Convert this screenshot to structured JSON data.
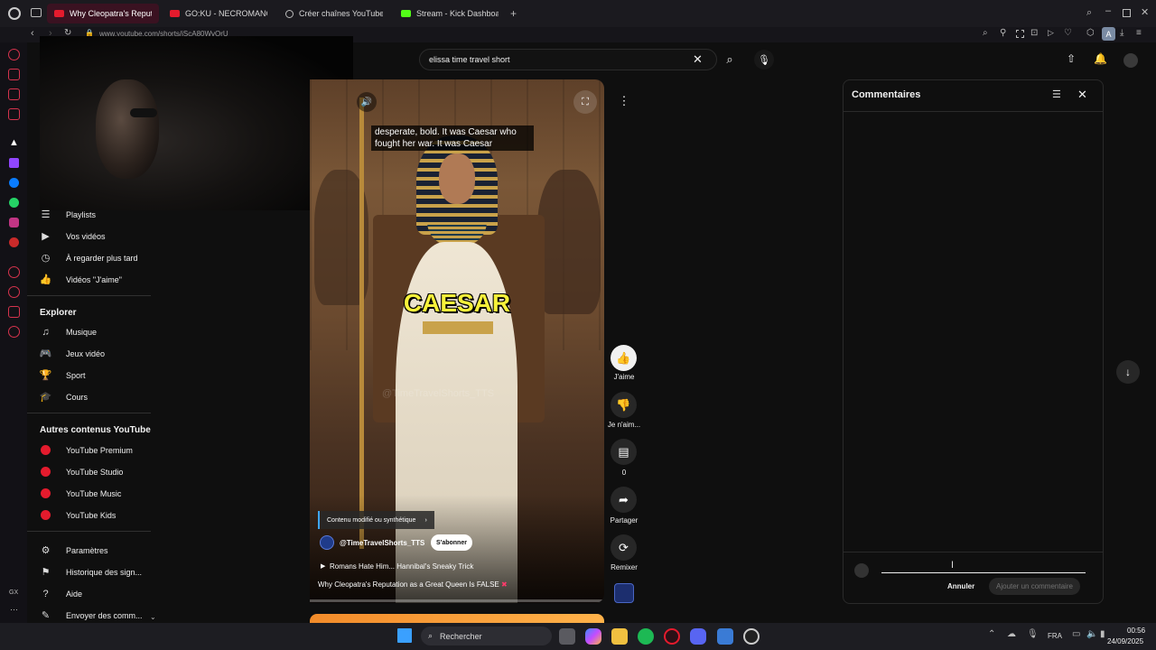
{
  "browser": {
    "tabs": [
      {
        "label": "Why Cleopatra's Reputat",
        "active": true
      },
      {
        "label": "GO:KU - NECROMANCY",
        "active": false
      },
      {
        "label": "Créer chaînes YouTube K",
        "active": false
      },
      {
        "label": "Stream - Kick Dashboard",
        "active": false
      }
    ],
    "url": "www.youtube.com/shorts/jScA80WvOrU"
  },
  "search": {
    "value": "elissa time travel short"
  },
  "nav": {
    "you_items": [
      "Playlists",
      "Vos vidéos",
      "À regarder plus tard",
      "Vidéos \"J'aime\""
    ],
    "explore_heading": "Explorer",
    "explore_items": [
      "Musique",
      "Jeux vidéo",
      "Sport",
      "Cours"
    ],
    "more_heading": "Autres contenus YouTube",
    "more_items": [
      "YouTube Premium",
      "YouTube Studio",
      "YouTube Music",
      "YouTube Kids"
    ],
    "bottom_items": [
      "Paramètres",
      "Historique des sign...",
      "Aide",
      "Envoyer des comm..."
    ]
  },
  "video": {
    "caption": "desperate, bold. It was Caesar who fought her war. It was Caesar",
    "big_word": "CAESAR",
    "watermark": "@TimeTravelShorts_TTS",
    "notice": "Contenu modifié ou synthétique",
    "channel": "@TimeTravelShorts_TTS",
    "subscribe": "S'abonner",
    "next_link": "Romans Hate Him... Hannibal's Sneaky Trick",
    "title": "Why Cleopatra's Reputation as a Great Queen Is FALSE",
    "title_emoji": "✖"
  },
  "actions": {
    "like": "J'aime",
    "dislike": "Je n'aim...",
    "comments_count": "0",
    "share": "Partager",
    "remix": "Remixer"
  },
  "comments": {
    "title": "Commentaires",
    "cancel": "Annuler",
    "submit": "Ajouter un commentaire"
  },
  "taskbar": {
    "search": "Rechercher",
    "lang": "FRA",
    "time": "00:56",
    "date": "24/09/2025"
  },
  "gx_label": "GX",
  "colors": {
    "accent": "#e41b2d",
    "kick": "#53fc18",
    "caption_yellow": "#f7f13a"
  }
}
